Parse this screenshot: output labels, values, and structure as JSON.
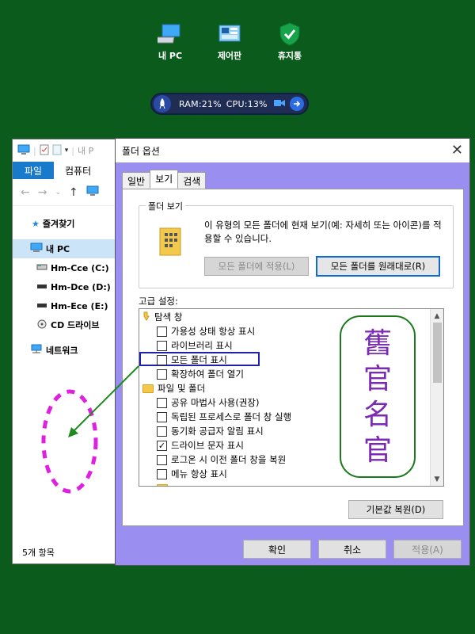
{
  "desktop": {
    "icons": [
      {
        "name": "my-pc",
        "label": "내 PC"
      },
      {
        "name": "control-panel",
        "label": "제어판"
      },
      {
        "name": "recycle-bin",
        "label": "휴지통"
      }
    ],
    "monitor": {
      "ram": "RAM:21%",
      "cpu": "CPU:13%"
    }
  },
  "explorer": {
    "title_fragment": "내 P",
    "ribbon": {
      "file": "파일",
      "computer": "컴퓨터"
    },
    "tree": [
      "즐겨찾기",
      "내 PC",
      "Hm-Cce (C:)",
      "Hm-Dce (D:)",
      "Hm-Ece (E:)",
      "CD 드라이브",
      "네트워크"
    ],
    "status": "5개 항목"
  },
  "dialog": {
    "title": "폴더 옵션",
    "tabs": [
      "일반",
      "보기",
      "검색"
    ],
    "folder_view": {
      "title": "폴더 보기",
      "desc": "이 유형의 모든 폴더에 현재 보기(예: 자세히 또는 아이콘)를 적용할 수 있습니다.",
      "apply_btn": "모든 폴더에 적용(L)",
      "reset_btn": "모든 폴더를 원래대로(R)"
    },
    "advanced": {
      "label": "고급 설정:",
      "items": [
        {
          "text": "탐색 창",
          "kind": "folder"
        },
        {
          "text": "가용성 상태 항상 표시",
          "kind": "check",
          "checked": false
        },
        {
          "text": "라이브러리 표시",
          "kind": "check",
          "checked": false
        },
        {
          "text": "모든 폴더 표시",
          "kind": "check",
          "checked": false
        },
        {
          "text": "확장하여 폴더 열기",
          "kind": "check",
          "checked": false
        },
        {
          "text": "파일 및 폴더",
          "kind": "folder"
        },
        {
          "text": "공유 마법사 사용(권장)",
          "kind": "check",
          "checked": false
        },
        {
          "text": "독립된 프로세스로 폴더 창 실행",
          "kind": "check",
          "checked": false
        },
        {
          "text": "동기화 공급자 알림 표시",
          "kind": "check",
          "checked": false
        },
        {
          "text": "드라이브 문자 표시",
          "kind": "check",
          "checked": true
        },
        {
          "text": "로그온 시 이전 폴더 창을 복원",
          "kind": "check",
          "checked": false
        },
        {
          "text": "메뉴 항상 표시",
          "kind": "check",
          "checked": false
        }
      ],
      "check_mark": "✓"
    },
    "callout_chars": [
      "舊",
      "官",
      "名",
      "官"
    ],
    "restore_btn": "기본값 복원(D)",
    "ok": "확인",
    "cancel": "취소",
    "apply": "적용(A)"
  }
}
